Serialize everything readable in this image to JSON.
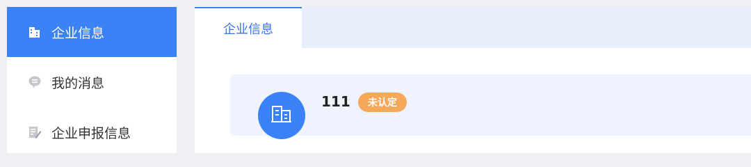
{
  "sidebar": {
    "items": [
      {
        "label": "企业信息",
        "icon": "building-icon",
        "active": true
      },
      {
        "label": "我的消息",
        "icon": "message-icon",
        "active": false
      },
      {
        "label": "企业申报信息",
        "icon": "edit-document-icon",
        "active": false
      }
    ]
  },
  "main": {
    "tabs": [
      {
        "label": "企业信息"
      }
    ],
    "company": {
      "name": "111",
      "status": "未认定",
      "avatar_icon": "building-icon"
    }
  },
  "colors": {
    "accent": "#3b82f6",
    "badge": "#f5a85a",
    "card_bg": "#eef3fd"
  }
}
